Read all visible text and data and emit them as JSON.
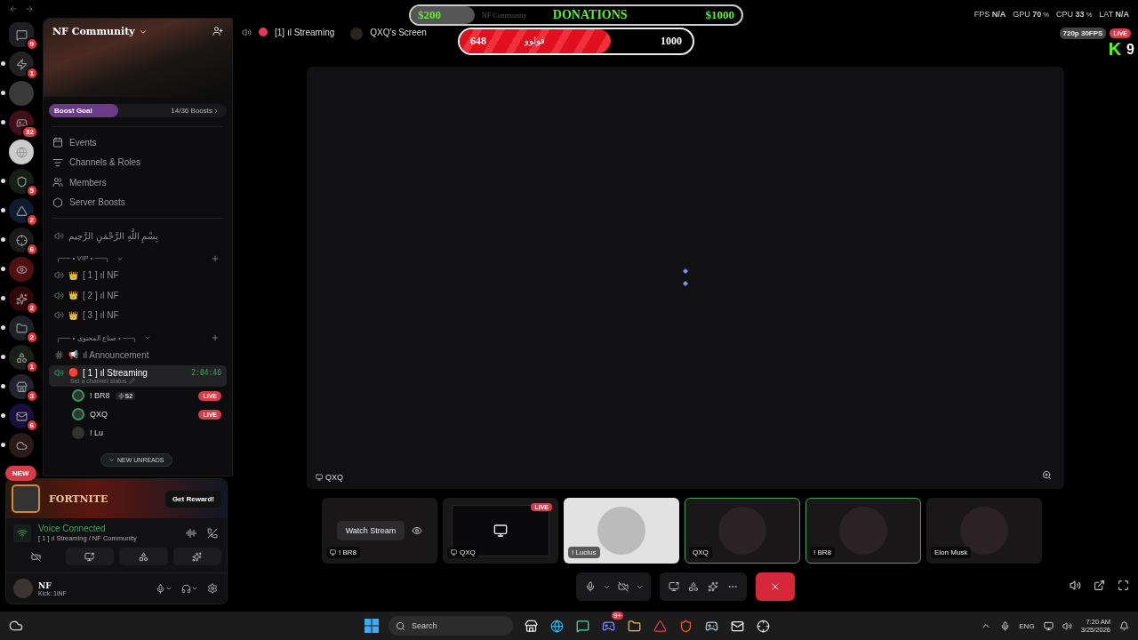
{
  "server_rail": {
    "servers": [
      {
        "badge": "9",
        "unread": false
      },
      {
        "badge": "1",
        "unread": true
      },
      {
        "unread": true
      },
      {
        "badge": "32",
        "unread": true
      },
      {
        "unread": false
      },
      {
        "badge": "5",
        "unread": true
      },
      {
        "badge": "2",
        "unread": true
      },
      {
        "badge": "6",
        "unread": true
      },
      {
        "unread": true
      },
      {
        "badge": "2",
        "unread": true
      },
      {
        "badge": "2",
        "unread": true
      },
      {
        "badge": "1",
        "unread": true
      },
      {
        "badge": "3",
        "unread": true
      },
      {
        "badge": "6",
        "unread": true
      },
      {
        "unread": true
      }
    ],
    "new_pill": "NEW"
  },
  "server": {
    "name": "NF Community",
    "boost": {
      "label": "Boost Goal",
      "level": 0.39,
      "count": "14/36 Boosts"
    },
    "menu": [
      {
        "kind": "events",
        "label": "Events"
      },
      {
        "kind": "channels",
        "label": "Channels & Roles"
      },
      {
        "kind": "members",
        "label": "Members"
      },
      {
        "kind": "boosts",
        "label": "Server Boosts"
      }
    ],
    "channels": [
      {
        "kind": "voice",
        "name": "بِسْمِ اللَّهِ الرَّحْمَنِ الرَّحِيم",
        "selected": false
      },
      {
        "kind": "category",
        "name": "╭── • VIP • ──╮"
      },
      {
        "kind": "voice",
        "name": "[ 1 ] ıl NF",
        "emoji": "👑",
        "selected": false
      },
      {
        "kind": "voice",
        "name": "[ 2 ] ıl NF",
        "emoji": "👑",
        "selected": false
      },
      {
        "kind": "voice",
        "name": "[ 3 ] ıl NF",
        "emoji": "👑",
        "selected": false
      },
      {
        "kind": "category",
        "name": "╭── • صناع المحتوى • ──╮"
      },
      {
        "kind": "text",
        "name": "ıl Announcement",
        "emoji": "📢",
        "selected": false
      },
      {
        "kind": "voice",
        "name": "[ 1 ] ıl Streaming",
        "emoji": "🔴",
        "selected": true,
        "timer": "2:04:46",
        "status": "Set a channel status",
        "members": [
          {
            "name": "! BR8",
            "tag": "S2",
            "live": "LIVE",
            "speaking": true
          },
          {
            "name": "QXQ",
            "live": "LIVE",
            "speaking": true
          },
          {
            "name": "! Lu",
            "speaking": false
          }
        ]
      }
    ],
    "new_unreads": "NEW UNREADS"
  },
  "promo": {
    "title": "FORTNITE",
    "button": "Get Reward!"
  },
  "voice": {
    "status": "Voice Connected",
    "channel": "[ 1 ] ıl Streaming / NF Community"
  },
  "user": {
    "name": "NF",
    "status": "Kick: 1iNF"
  },
  "header": {
    "channel": "[1] ıl Streaming",
    "screen": "QXQ's Screen"
  },
  "donation": {
    "min": "$200",
    "caption": "NF Community",
    "title": "DONATIONS",
    "max": "$1000",
    "current": "648",
    "label": "فولوو",
    "goal": "1000",
    "level": 0.648
  },
  "stats": [
    {
      "label": "FPS",
      "value": "N/A"
    },
    {
      "label": "GPU",
      "value": "70",
      "unit": "%"
    },
    {
      "label": "CPU",
      "value": "33",
      "unit": "%"
    },
    {
      "label": "LAT",
      "value": "N/A"
    }
  ],
  "quality": "720p 30FPS",
  "live": "LIVE",
  "kick": {
    "letter": "K",
    "count": "9"
  },
  "stage": {
    "label": "QXQ"
  },
  "tiles": [
    {
      "kind": "stream",
      "name": "! BR8",
      "button": "Watch Stream",
      "speaking": false
    },
    {
      "kind": "stream",
      "name": "QXQ",
      "live": "LIVE",
      "speaking": false
    },
    {
      "kind": "avatar",
      "name": "! Lucius",
      "light": true,
      "speaking": false
    },
    {
      "kind": "avatar",
      "name": "QXQ",
      "light": false,
      "speaking": true
    },
    {
      "kind": "avatar",
      "name": "! BR8",
      "light": false,
      "speaking": true
    },
    {
      "kind": "avatar",
      "name": "Elon Musk",
      "light": false,
      "speaking": false
    }
  ],
  "taskbar": {
    "search": "Search",
    "badge": "9+",
    "language": "ENG",
    "time": "7:20 AM",
    "date": "3/25/2026"
  }
}
